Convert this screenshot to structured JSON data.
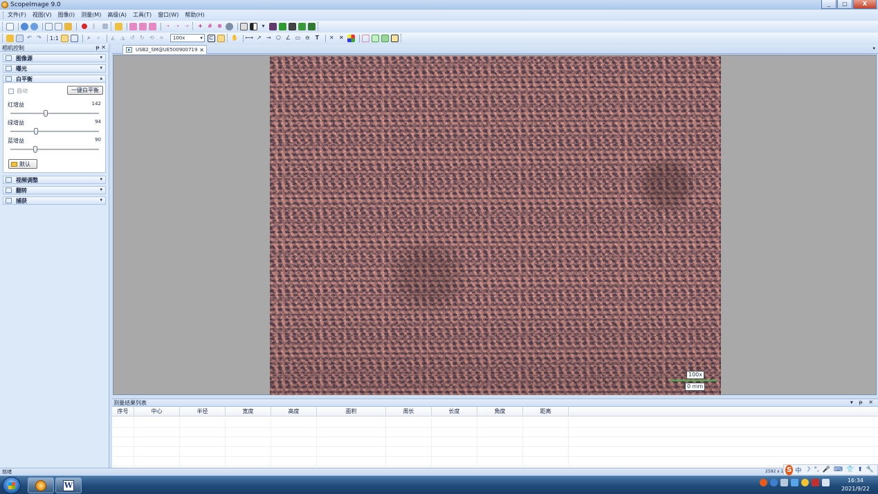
{
  "window": {
    "title": "ScopeImage 9.0",
    "controls": {
      "minimize": "_",
      "maximize": "□",
      "close": "X"
    }
  },
  "menu": [
    "文件(F)",
    "视图(V)",
    "图像(I)",
    "测量(M)",
    "高级(A)",
    "工具(T)",
    "窗口(W)",
    "帮助(H)"
  ],
  "toolbar": {
    "ratio_label": "1:1",
    "zoom_value": "100x"
  },
  "left_panel": {
    "title": "相机控制",
    "pin": "ᵽ ✕",
    "sections": {
      "image_source": "图像源",
      "exposure": "曝光",
      "white_balance": "白平衡",
      "video_adjust": "视频调整",
      "flip": "翻转",
      "capture": "捕获"
    },
    "white_balance": {
      "auto_label": "自动",
      "one_key_button": "一键白平衡",
      "sliders": [
        {
          "label": "红增益",
          "value": "142",
          "fraction": 0.39
        },
        {
          "label": "绿增益",
          "value": "94",
          "fraction": 0.28
        },
        {
          "label": "蓝增益",
          "value": "90",
          "fraction": 0.27
        }
      ],
      "default_button": "默认"
    }
  },
  "document": {
    "tab_title": "USB2_SM@UE500900719",
    "tab_close": "✕",
    "scale_magnification": "100x",
    "scale_length": "0 mm"
  },
  "results": {
    "title": "测量结果列表",
    "controls": "▾ ᵽ ✕",
    "columns": [
      "序号",
      "中心",
      "半径",
      "宽度",
      "高度",
      "面积",
      "周长",
      "长度",
      "角度",
      "距离"
    ]
  },
  "status": {
    "ready": "就绪",
    "dimensions": "2592 x 1"
  },
  "ime": {
    "logo": "S",
    "glyphs": [
      "中",
      "☽",
      "°,",
      "🎤",
      "⌨",
      "👕",
      "⬆",
      "🔧"
    ]
  },
  "taskbar": {
    "time": "16:34",
    "date": "2021/9/22"
  }
}
